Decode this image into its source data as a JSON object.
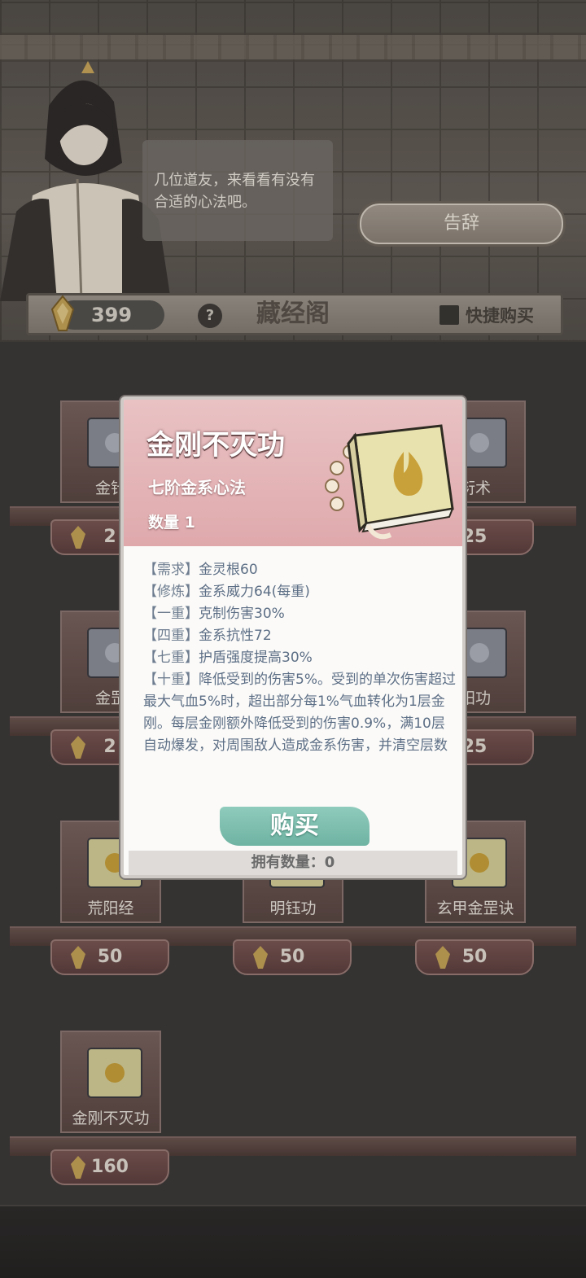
{
  "npc": {
    "speech": "几位道友，来看看有没有合适的心法吧。",
    "farewell_label": "告辞"
  },
  "header": {
    "currency": "399",
    "help_label": "?",
    "title": "藏经阁",
    "quick_buy_label": "快捷购买"
  },
  "shelves": [
    {
      "name": "金针",
      "price": "2"
    },
    {
      "name": "衍术",
      "price": "25"
    },
    {
      "name": "金罡",
      "price": "2"
    },
    {
      "name": "阳功",
      "price": "25"
    },
    {
      "name": "荒阳经",
      "price": "50"
    },
    {
      "name": "明钰功",
      "price": "50"
    },
    {
      "name": "玄甲金罡诀",
      "price": "50"
    },
    {
      "name": "金刚不灭功",
      "price": "160"
    }
  ],
  "modal": {
    "title": "金刚不灭功",
    "subtitle": "七阶金系心法",
    "quantity": "数量 1",
    "lines": [
      {
        "tag": "【需求】",
        "text": "金灵根60"
      },
      {
        "tag": "【修炼】",
        "text": "金系威力64(每重)"
      },
      {
        "tag": "【一重】",
        "text": "克制伤害30%"
      },
      {
        "tag": "【四重】",
        "text": "金系抗性72"
      },
      {
        "tag": "【七重】",
        "text": "护盾强度提高30%"
      },
      {
        "tag": "【十重】",
        "text": "降低受到的伤害5%。受到的单次伤害超过最大气血5%时，超出部分每1%气血转化为1层金刚。每层金刚额外降低受到的伤害0.9%，满10层自动爆发，对周围敌人造成金系伤害，并清空层数"
      }
    ],
    "buy_label": "购买",
    "owned_label": "拥有数量：0"
  }
}
